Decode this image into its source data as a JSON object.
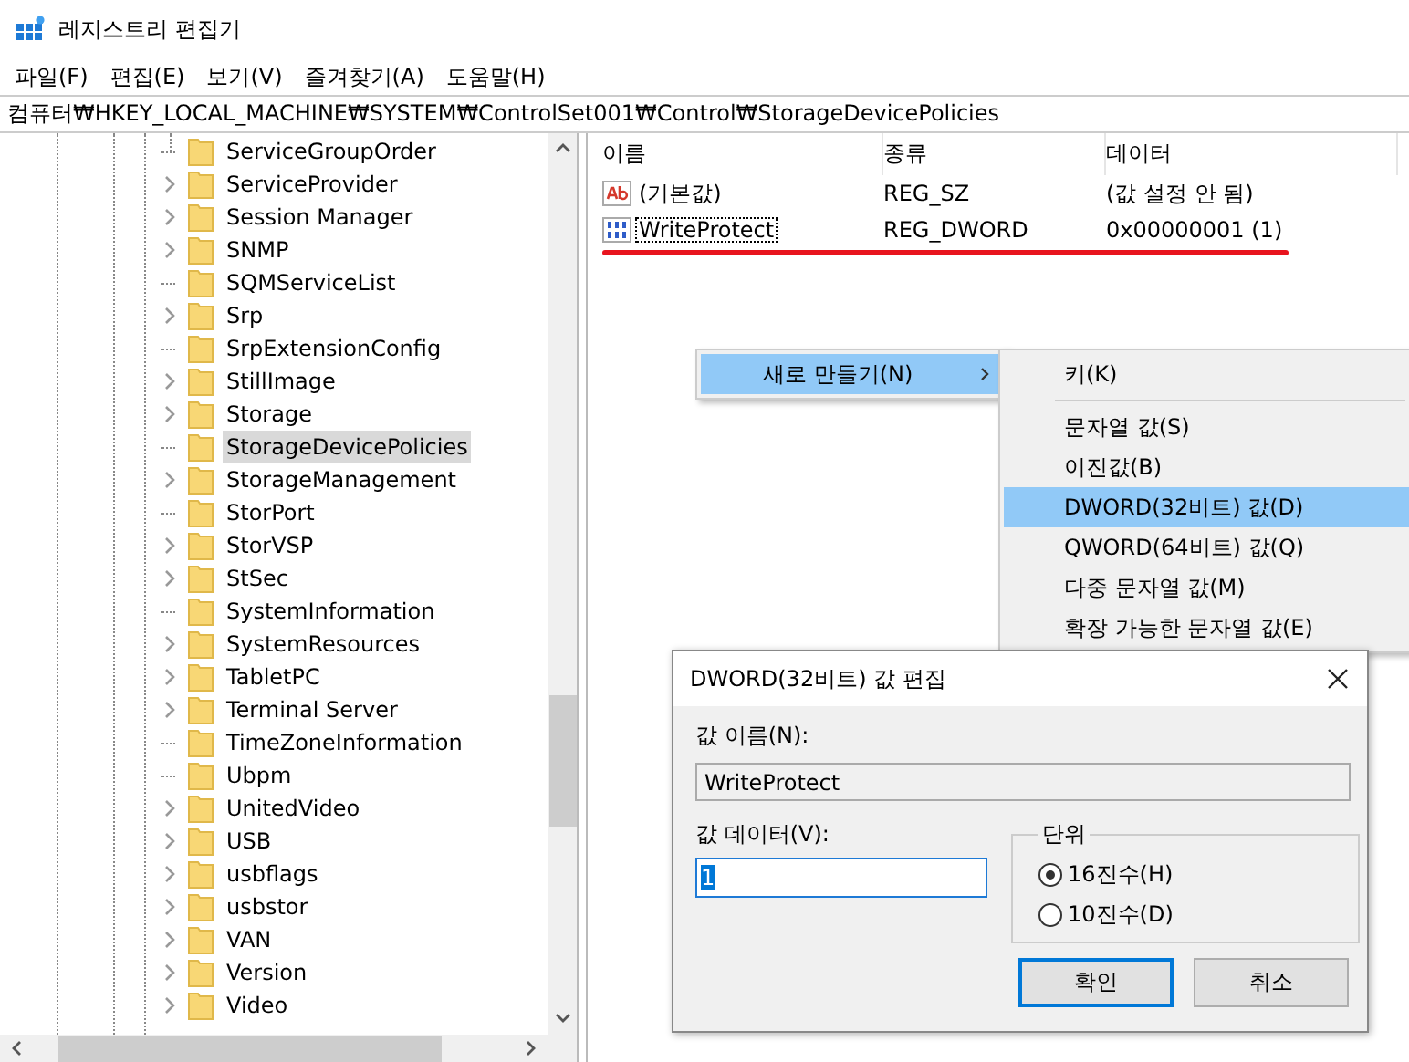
{
  "window": {
    "title": "레지스트리 편집기"
  },
  "menu": [
    "파일(F)",
    "편집(E)",
    "보기(V)",
    "즐겨찾기(A)",
    "도움말(H)"
  ],
  "address": "컴퓨터₩HKEY_LOCAL_MACHINE₩SYSTEM₩ControlSet001₩Control₩StorageDevicePolicies",
  "tree": {
    "items": [
      {
        "label": "ServiceGroupOrder",
        "has_children": false,
        "selected": false
      },
      {
        "label": "ServiceProvider",
        "has_children": true,
        "selected": false
      },
      {
        "label": "Session Manager",
        "has_children": true,
        "selected": false
      },
      {
        "label": "SNMP",
        "has_children": true,
        "selected": false
      },
      {
        "label": "SQMServiceList",
        "has_children": false,
        "selected": false
      },
      {
        "label": "Srp",
        "has_children": true,
        "selected": false
      },
      {
        "label": "SrpExtensionConfig",
        "has_children": false,
        "selected": false
      },
      {
        "label": "StillImage",
        "has_children": true,
        "selected": false
      },
      {
        "label": "Storage",
        "has_children": true,
        "selected": false
      },
      {
        "label": "StorageDevicePolicies",
        "has_children": false,
        "selected": true
      },
      {
        "label": "StorageManagement",
        "has_children": true,
        "selected": false
      },
      {
        "label": "StorPort",
        "has_children": false,
        "selected": false
      },
      {
        "label": "StorVSP",
        "has_children": true,
        "selected": false
      },
      {
        "label": "StSec",
        "has_children": true,
        "selected": false
      },
      {
        "label": "SystemInformation",
        "has_children": false,
        "selected": false
      },
      {
        "label": "SystemResources",
        "has_children": true,
        "selected": false
      },
      {
        "label": "TabletPC",
        "has_children": true,
        "selected": false
      },
      {
        "label": "Terminal Server",
        "has_children": true,
        "selected": false
      },
      {
        "label": "TimeZoneInformation",
        "has_children": false,
        "selected": false
      },
      {
        "label": "Ubpm",
        "has_children": false,
        "selected": false
      },
      {
        "label": "UnitedVideo",
        "has_children": true,
        "selected": false
      },
      {
        "label": "USB",
        "has_children": true,
        "selected": false
      },
      {
        "label": "usbflags",
        "has_children": true,
        "selected": false
      },
      {
        "label": "usbstor",
        "has_children": true,
        "selected": false
      },
      {
        "label": "VAN",
        "has_children": true,
        "selected": false
      },
      {
        "label": "Version",
        "has_children": true,
        "selected": false
      },
      {
        "label": "Video",
        "has_children": true,
        "selected": false
      }
    ]
  },
  "values": {
    "columns": [
      "이름",
      "종류",
      "데이터"
    ],
    "rows": [
      {
        "kind": "string",
        "name": "(기본값)",
        "type": "REG_SZ",
        "data": "(값 설정 안 됨)",
        "focused": false,
        "underlined": false
      },
      {
        "kind": "dword",
        "name": "WriteProtect",
        "type": "REG_DWORD",
        "data": "0x00000001 (1)",
        "focused": true,
        "underlined": true
      }
    ]
  },
  "context_menu": {
    "items": [
      {
        "label": "새로 만들기(N)",
        "selected": true,
        "has_submenu": true
      }
    ]
  },
  "submenu": {
    "items": [
      {
        "kind": "item",
        "label": "키(K)",
        "selected": false
      },
      {
        "kind": "separator"
      },
      {
        "kind": "item",
        "label": "문자열 값(S)",
        "selected": false
      },
      {
        "kind": "item",
        "label": "이진값(B)",
        "selected": false
      },
      {
        "kind": "item",
        "label": "DWORD(32비트) 값(D)",
        "selected": true
      },
      {
        "kind": "item",
        "label": "QWORD(64비트) 값(Q)",
        "selected": false
      },
      {
        "kind": "item",
        "label": "다중 문자열 값(M)",
        "selected": false
      },
      {
        "kind": "item",
        "label": "확장 가능한 문자열 값(E)",
        "selected": false
      }
    ]
  },
  "dialog": {
    "title": "DWORD(32비트) 값 편집",
    "name_label": "값 이름(N):",
    "name_value": "WriteProtect",
    "data_label": "값 데이터(V):",
    "data_value": "1",
    "base_label": "단위",
    "bases": [
      {
        "label": "16진수(H)",
        "selected": true
      },
      {
        "label": "10진수(D)",
        "selected": false
      }
    ],
    "buttons": [
      {
        "label": "확인",
        "default": true
      },
      {
        "label": "취소",
        "default": false
      }
    ]
  }
}
